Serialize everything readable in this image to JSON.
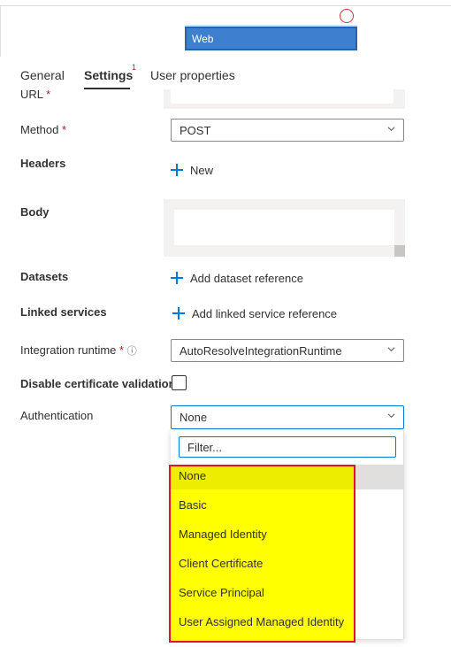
{
  "pipeline_canvas": {
    "activity_label": "Web"
  },
  "tabs": [
    {
      "label": "General"
    },
    {
      "label": "Settings",
      "badge": "1"
    },
    {
      "label": "User properties"
    }
  ],
  "form": {
    "url_label": "URL",
    "url_value": "",
    "method_label": "Method",
    "method_value": "POST",
    "headers_label": "Headers",
    "headers_new": "New",
    "body_label": "Body",
    "datasets_label": "Datasets",
    "datasets_add": "Add dataset reference",
    "linked_label": "Linked services",
    "linked_add": "Add linked service reference",
    "runtime_label": "Integration runtime",
    "runtime_value": "AutoResolveIntegrationRuntime",
    "disable_cert_label": "Disable certificate validation",
    "auth_label": "Authentication",
    "auth_value": "None",
    "required_marker": "*",
    "info_icon": "ⓘ"
  },
  "auth_dropdown": {
    "filter_placeholder": "Filter...",
    "options": [
      "None",
      "Basic",
      "Managed Identity",
      "Client Certificate",
      "Service Principal",
      "User Assigned Managed Identity"
    ],
    "selected": "None"
  },
  "colors": {
    "accent": "#0078d4",
    "required": "#a4262c",
    "highlight": "#ffff00",
    "highlight_border": "#e81123",
    "activity_fill": "#3f7fcf"
  }
}
